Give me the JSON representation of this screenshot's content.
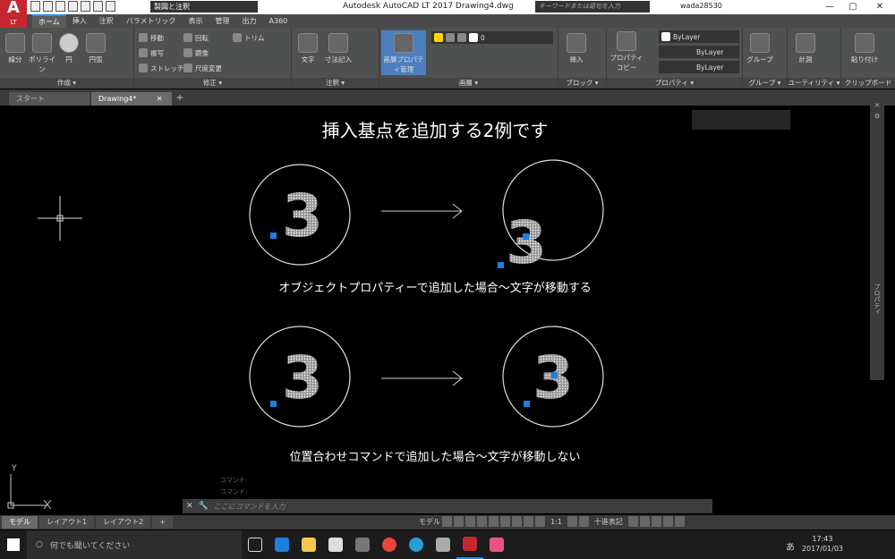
{
  "titlebar": {
    "logo": "A",
    "logo_sub": "LT",
    "workspace": "製図と注釈",
    "title": "Autodesk AutoCAD LT 2017    Drawing4.dwg",
    "search_placeholder": "キーワードまたは語句を入力",
    "user": "wada28530",
    "min": "—",
    "max": "▢",
    "close": "✕"
  },
  "ribbon_tabs": [
    "ホーム",
    "挿入",
    "注釈",
    "パラメトリック",
    "表示",
    "管理",
    "出力",
    "A360"
  ],
  "panels": {
    "draw": {
      "label": "作成 ▾",
      "line": "線分",
      "polyline": "ポリライン",
      "circle": "円",
      "arc": "円弧"
    },
    "modify": {
      "label": "修正 ▾",
      "move": "移動",
      "rotate": "回転",
      "trim": "トリム",
      "copy": "複写",
      "mirror": "鏡像",
      "stretch": "ストレッチ",
      "scale": "尺度変更"
    },
    "annotation": {
      "label": "注釈 ▾",
      "text": "文字",
      "dimension": "寸法記入"
    },
    "layers": {
      "label": "画層 ▾",
      "properties": "画層プロパティ管理",
      "current": "0"
    },
    "block": {
      "label": "ブロック ▾",
      "insert": "挿入"
    },
    "properties": {
      "label": "プロパティ ▾",
      "copy": "プロパティコピー",
      "bylayer1": "ByLayer",
      "bylayer2": "ByLayer",
      "bylayer3": "ByLayer"
    },
    "group": {
      "label": "グループ ▾",
      "group": "グループ"
    },
    "utilities": {
      "label": "ユーティリティ ▾",
      "measure": "計測"
    },
    "clipboard": {
      "label": "クリップボード",
      "paste": "貼り付け"
    }
  },
  "doc_tabs": {
    "start": "スタート",
    "drawing": "Drawing4*",
    "close": "✕",
    "add": "+"
  },
  "drawing": {
    "heading": "挿入基点を追加する2例です",
    "caption1": "オブジェクトプロパティーで追加した場合～文字が移動する",
    "caption2": "位置合わせコマンドで追加した場合～文字が移動しない",
    "digit": "3",
    "arrow": "→",
    "ucs_y": "Y",
    "ucs_x": "X"
  },
  "right_panel": {
    "label": "プロパティ"
  },
  "command": {
    "placeholder": "ここにコマンドを入力",
    "hist1": "コマンド:",
    "hist2": "コマンド:"
  },
  "layout_tabs": [
    "モデル",
    "レイアウト1",
    "レイアウト2"
  ],
  "status": {
    "model": "モデル",
    "scale": "1:1",
    "units": "十進表記"
  },
  "taskbar": {
    "search": "何でも聞いてください",
    "time": "17:43",
    "date": "2017/01/03",
    "ime": "あ"
  },
  "colors": {
    "accent": "#1e90ff",
    "logo": "#c6262e",
    "point": "#1e7fe0"
  }
}
